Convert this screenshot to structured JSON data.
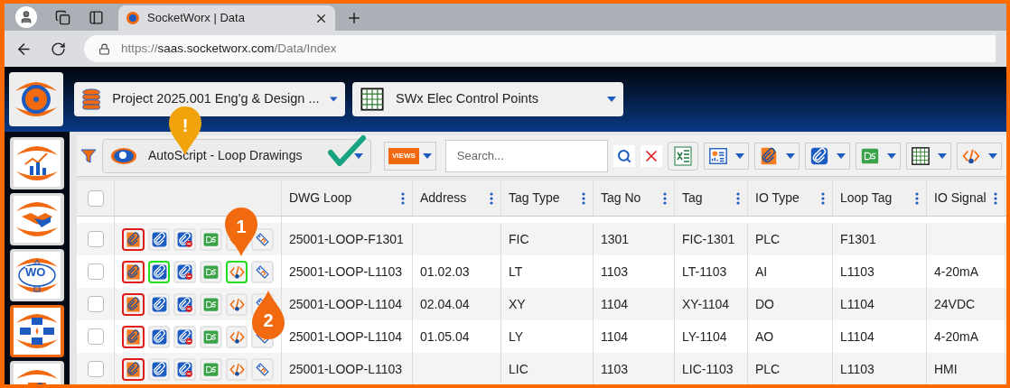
{
  "browser": {
    "tab_title": "SocketWorx | Data",
    "url_prefix": "https://",
    "url_host": "saas.socketworx.com",
    "url_path": "/Data/Index"
  },
  "header": {
    "project": "Project 2025.001 Eng'g & Design ...",
    "table": "SWx Elec Control Points"
  },
  "sidebar": {
    "items": [
      {
        "kind": "chart",
        "selected": false
      },
      {
        "kind": "handshake",
        "selected": false
      },
      {
        "kind": "workorder",
        "label": "WO",
        "selected": false
      },
      {
        "kind": "tables",
        "selected": true
      },
      {
        "kind": "attach",
        "selected": false
      }
    ]
  },
  "toolbar": {
    "view": "AutoScript - Loop Drawings",
    "views_label": "VIEWS",
    "search": {
      "placeholder": "Search..."
    },
    "menus": [
      {
        "kind": "report"
      },
      {
        "kind": "pdf"
      },
      {
        "kind": "attach"
      },
      {
        "kind": "ds"
      },
      {
        "kind": "grid"
      },
      {
        "kind": "code"
      }
    ]
  },
  "table": {
    "all_checked": false,
    "columns": [
      "DWG Loop",
      "Address",
      "Tag Type",
      "Tag No",
      "Tag",
      "IO Type",
      "Loop Tag",
      "IO Signal"
    ],
    "rows": [
      {
        "checked": false,
        "attach_linked": false,
        "script_linked": false,
        "cells": [
          "25001-LOOP-F1301",
          "",
          "FIC",
          "1301",
          "FIC-1301",
          "PLC",
          "F1301",
          ""
        ]
      },
      {
        "checked": false,
        "attach_linked": true,
        "script_linked": true,
        "cells": [
          "25001-LOOP-L1103",
          "01.02.03",
          "LT",
          "1103",
          "LT-1103",
          "AI",
          "L1103",
          "4-20mA"
        ]
      },
      {
        "checked": false,
        "attach_linked": false,
        "script_linked": false,
        "cells": [
          "25001-LOOP-L1104",
          "02.04.04",
          "XY",
          "1104",
          "XY-1104",
          "DO",
          "L1104",
          "24VDC"
        ]
      },
      {
        "checked": false,
        "attach_linked": false,
        "script_linked": false,
        "cells": [
          "25001-LOOP-L1104",
          "01.05.04",
          "LY",
          "1104",
          "LY-1104",
          "AO",
          "L1104",
          "4-20mA"
        ]
      },
      {
        "checked": false,
        "attach_linked": false,
        "script_linked": false,
        "cells": [
          "25001-LOOP-L1103",
          "",
          "LIC",
          "1103",
          "LIC-1103",
          "PLC",
          "L1103",
          "HMI"
        ]
      }
    ]
  },
  "callouts": [
    {
      "kind": "warning",
      "label": "!"
    },
    {
      "kind": "number",
      "label": "1"
    },
    {
      "kind": "number",
      "label": "2"
    }
  ]
}
